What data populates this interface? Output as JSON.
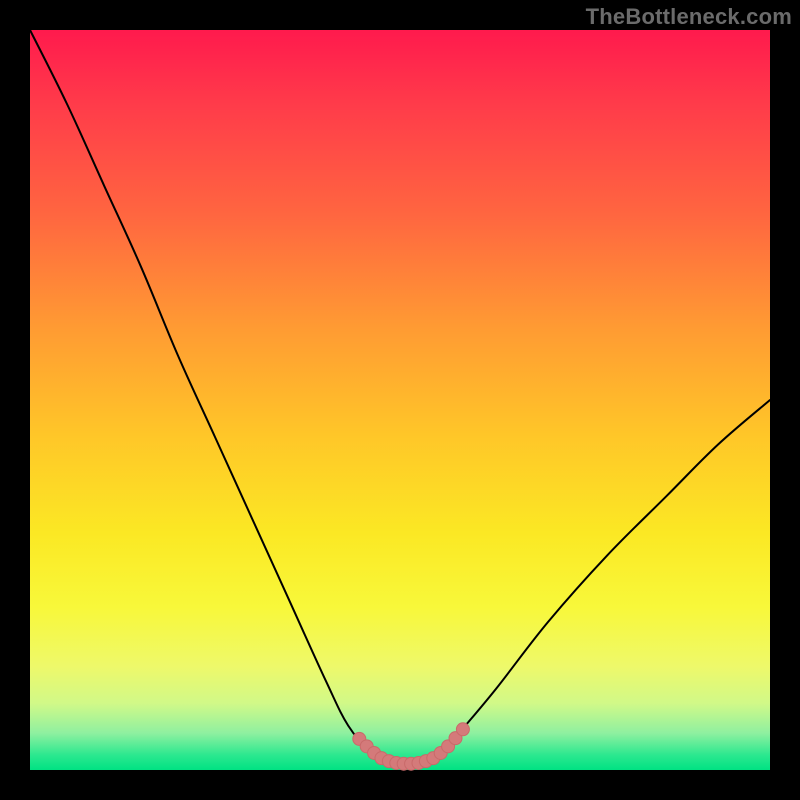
{
  "watermark": "TheBottleneck.com",
  "colors": {
    "background": "#000000",
    "curve": "#000000",
    "marker_fill": "#d47a7a",
    "marker_stroke": "#c96a6a",
    "gradient_top": "#ff1a4d",
    "gradient_bottom": "#00e283"
  },
  "chart_data": {
    "type": "line",
    "title": "",
    "xlabel": "",
    "ylabel": "",
    "xlim": [
      0,
      100
    ],
    "ylim": [
      0,
      100
    ],
    "grid": false,
    "series": [
      {
        "name": "bottleneck-curve",
        "x": [
          0,
          5,
          10,
          15,
          20,
          25,
          30,
          35,
          40,
          43,
          46,
          48,
          50,
          52,
          54,
          56,
          58,
          63,
          70,
          78,
          86,
          93,
          100
        ],
        "y": [
          100,
          90,
          79,
          68,
          56,
          45,
          34,
          23,
          12,
          6,
          2.5,
          1.2,
          0.8,
          0.8,
          1.2,
          2.5,
          5,
          11,
          20,
          29,
          37,
          44,
          50
        ]
      }
    ],
    "markers": [
      {
        "x": 44.5,
        "y": 4.2
      },
      {
        "x": 45.5,
        "y": 3.2
      },
      {
        "x": 46.5,
        "y": 2.3
      },
      {
        "x": 47.5,
        "y": 1.6
      },
      {
        "x": 48.5,
        "y": 1.2
      },
      {
        "x": 49.5,
        "y": 0.95
      },
      {
        "x": 50.5,
        "y": 0.85
      },
      {
        "x": 51.5,
        "y": 0.85
      },
      {
        "x": 52.5,
        "y": 0.95
      },
      {
        "x": 53.5,
        "y": 1.2
      },
      {
        "x": 54.5,
        "y": 1.6
      },
      {
        "x": 55.5,
        "y": 2.3
      },
      {
        "x": 56.5,
        "y": 3.2
      },
      {
        "x": 57.5,
        "y": 4.3
      },
      {
        "x": 58.5,
        "y": 5.5
      }
    ],
    "annotations": []
  }
}
